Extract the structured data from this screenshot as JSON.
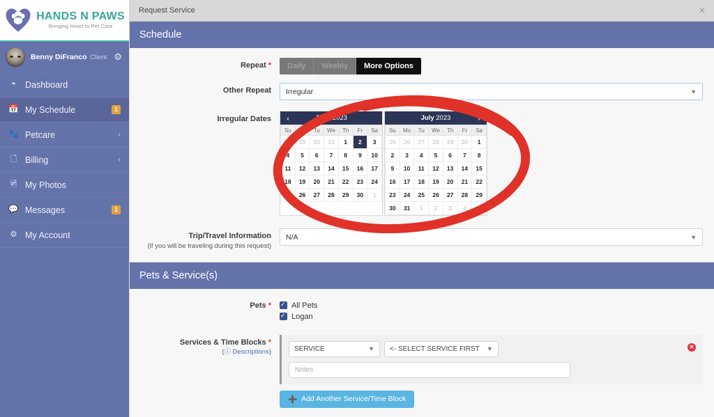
{
  "brand": {
    "logo_title": "HANDS N PAWS",
    "logo_tagline": "Bringing Heart to Pet Care",
    "teal": "#3aa597",
    "sidebar_bg": "#6573ab",
    "accent_dark": "#2d3556"
  },
  "sidebar": {
    "profile": {
      "name": "Benny DiFranco",
      "role": "Client",
      "gear_icon": "gear-icon"
    },
    "items": [
      {
        "label": "Dashboard",
        "icon": "dashboard-icon",
        "badge": "",
        "caret": "",
        "active": false
      },
      {
        "label": "My Schedule",
        "icon": "calendar-icon",
        "badge": "1",
        "caret": "",
        "active": true
      },
      {
        "label": "Petcare",
        "icon": "paw-icon",
        "badge": "",
        "caret": "‹",
        "active": false
      },
      {
        "label": "Billing",
        "icon": "document-icon",
        "badge": "",
        "caret": "‹",
        "active": false
      },
      {
        "label": "My Photos",
        "icon": "photo-icon",
        "badge": "",
        "caret": "",
        "active": false
      },
      {
        "label": "Messages",
        "icon": "chat-icon",
        "badge": "1",
        "caret": "",
        "active": false
      },
      {
        "label": "My Account",
        "icon": "cogs-icon",
        "badge": "",
        "caret": "",
        "active": false
      }
    ]
  },
  "modal": {
    "title": "Request Service",
    "close_icon": "close-icon"
  },
  "schedule": {
    "section_title": "Schedule",
    "repeat": {
      "label": "Repeat",
      "required": "*",
      "options": [
        {
          "label": "Daily",
          "state": "disabled"
        },
        {
          "label": "Weekly",
          "state": "disabled"
        },
        {
          "label": "More Options",
          "state": "active"
        }
      ]
    },
    "other_repeat": {
      "label": "Other Repeat",
      "value": "Irregular",
      "chevron_icon": "chevron-down-icon"
    },
    "irregular_dates": {
      "label": "Irregular Dates",
      "prev_icon": "chevron-left-icon",
      "next_icon": "chevron-right-icon"
    },
    "trip": {
      "label": "Trip/Travel Information",
      "sublabel": "(if you will be traveling during this request)",
      "value": "N/A",
      "chevron_icon": "chevron-down-icon"
    }
  },
  "calendars": [
    {
      "month": "June",
      "year": "2023",
      "has_prev": true,
      "has_next": false,
      "weekdays": [
        "Su",
        "Mo",
        "Tu",
        "We",
        "Th",
        "Fr",
        "Sa"
      ],
      "weeks": [
        [
          {
            "d": "28",
            "t": "mut"
          },
          {
            "d": "29",
            "t": "mut"
          },
          {
            "d": "30",
            "t": "mut"
          },
          {
            "d": "31",
            "t": "mut"
          },
          {
            "d": "1",
            "t": ""
          },
          {
            "d": "2",
            "t": "sel"
          },
          {
            "d": "3",
            "t": ""
          }
        ],
        [
          {
            "d": "4",
            "t": ""
          },
          {
            "d": "5",
            "t": ""
          },
          {
            "d": "6",
            "t": ""
          },
          {
            "d": "7",
            "t": ""
          },
          {
            "d": "8",
            "t": ""
          },
          {
            "d": "9",
            "t": ""
          },
          {
            "d": "10",
            "t": ""
          }
        ],
        [
          {
            "d": "11",
            "t": ""
          },
          {
            "d": "12",
            "t": ""
          },
          {
            "d": "13",
            "t": ""
          },
          {
            "d": "14",
            "t": ""
          },
          {
            "d": "15",
            "t": ""
          },
          {
            "d": "16",
            "t": ""
          },
          {
            "d": "17",
            "t": ""
          }
        ],
        [
          {
            "d": "18",
            "t": ""
          },
          {
            "d": "19",
            "t": ""
          },
          {
            "d": "20",
            "t": ""
          },
          {
            "d": "21",
            "t": ""
          },
          {
            "d": "22",
            "t": ""
          },
          {
            "d": "23",
            "t": ""
          },
          {
            "d": "24",
            "t": ""
          }
        ],
        [
          {
            "d": "25",
            "t": ""
          },
          {
            "d": "26",
            "t": ""
          },
          {
            "d": "27",
            "t": ""
          },
          {
            "d": "28",
            "t": ""
          },
          {
            "d": "29",
            "t": ""
          },
          {
            "d": "30",
            "t": ""
          },
          {
            "d": "1",
            "t": "mut"
          }
        ]
      ]
    },
    {
      "month": "July",
      "year": "2023",
      "has_prev": false,
      "has_next": true,
      "weekdays": [
        "Su",
        "Mo",
        "Tu",
        "We",
        "Th",
        "Fr",
        "Sa"
      ],
      "weeks": [
        [
          {
            "d": "25",
            "t": "mut"
          },
          {
            "d": "26",
            "t": "mut"
          },
          {
            "d": "27",
            "t": "mut"
          },
          {
            "d": "28",
            "t": "mut"
          },
          {
            "d": "29",
            "t": "mut"
          },
          {
            "d": "30",
            "t": "mut"
          },
          {
            "d": "1",
            "t": ""
          }
        ],
        [
          {
            "d": "2",
            "t": ""
          },
          {
            "d": "3",
            "t": ""
          },
          {
            "d": "4",
            "t": ""
          },
          {
            "d": "5",
            "t": ""
          },
          {
            "d": "6",
            "t": ""
          },
          {
            "d": "7",
            "t": ""
          },
          {
            "d": "8",
            "t": ""
          }
        ],
        [
          {
            "d": "9",
            "t": ""
          },
          {
            "d": "10",
            "t": ""
          },
          {
            "d": "11",
            "t": ""
          },
          {
            "d": "12",
            "t": ""
          },
          {
            "d": "13",
            "t": ""
          },
          {
            "d": "14",
            "t": ""
          },
          {
            "d": "15",
            "t": ""
          }
        ],
        [
          {
            "d": "16",
            "t": ""
          },
          {
            "d": "17",
            "t": ""
          },
          {
            "d": "18",
            "t": ""
          },
          {
            "d": "19",
            "t": ""
          },
          {
            "d": "20",
            "t": ""
          },
          {
            "d": "21",
            "t": ""
          },
          {
            "d": "22",
            "t": ""
          }
        ],
        [
          {
            "d": "23",
            "t": ""
          },
          {
            "d": "24",
            "t": ""
          },
          {
            "d": "25",
            "t": ""
          },
          {
            "d": "26",
            "t": ""
          },
          {
            "d": "27",
            "t": ""
          },
          {
            "d": "28",
            "t": ""
          },
          {
            "d": "29",
            "t": ""
          }
        ],
        [
          {
            "d": "30",
            "t": ""
          },
          {
            "d": "31",
            "t": ""
          },
          {
            "d": "1",
            "t": "mut"
          },
          {
            "d": "2",
            "t": "mut"
          },
          {
            "d": "3",
            "t": "mut"
          },
          {
            "d": "4",
            "t": "mut"
          },
          {
            "d": "5",
            "t": "mut"
          }
        ]
      ]
    }
  ],
  "pets_services": {
    "section_title": "Pets & Service(s)",
    "pets": {
      "label": "Pets",
      "required": "*",
      "items": [
        {
          "label": "All Pets",
          "checked": true
        },
        {
          "label": "Logan",
          "checked": true
        }
      ]
    },
    "services": {
      "label": "Services & Time Blocks",
      "required": "*",
      "descriptions_link": "Descriptions",
      "descriptions_prefix": "(",
      "descriptions_suffix": ")",
      "help_icon": "question-circle-icon",
      "service_select": "SERVICE",
      "timeblock_select": "<- SELECT SERVICE FIRST",
      "notes_placeholder": "Notes",
      "remove_icon": "remove-circle-icon",
      "add_button": "Add Another Service/Time Block",
      "add_icon": "plus-circle-icon"
    }
  },
  "annotation": {
    "type": "hand-drawn-ellipse",
    "color": "#e03228"
  }
}
